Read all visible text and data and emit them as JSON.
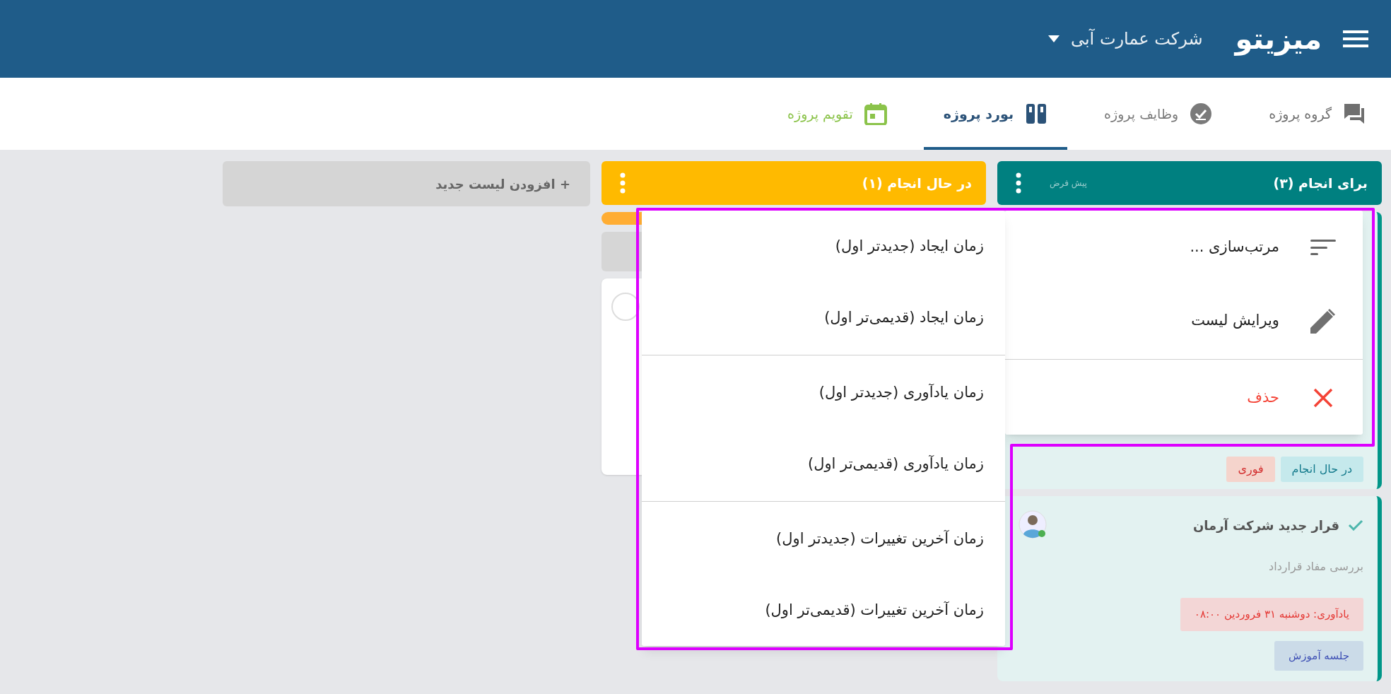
{
  "app": {
    "logo": "میزیتو",
    "company": "شرکت عمارت آبی"
  },
  "tabs": [
    {
      "label": "گروه پروژه",
      "kind": "chat",
      "color": "#6f6f6f",
      "selected": false
    },
    {
      "label": "وظایف پروژه",
      "kind": "tasks",
      "color": "#7a7a7a",
      "selected": false
    },
    {
      "label": "بورد پروژه",
      "kind": "board",
      "color": "#2b5278",
      "selected": true
    },
    {
      "label": "تقویم پروژه",
      "kind": "calendar",
      "color": "#8bc34a",
      "selected": false
    }
  ],
  "lists": [
    {
      "title": "برای انجام (۳)",
      "subtitle": "پیش فرض",
      "color": "#008080",
      "cards": [
        {
          "kind": "tags",
          "tags": [
            {
              "label": "در حال انجام",
              "kind": "status"
            },
            {
              "label": "فوری",
              "kind": "priority"
            }
          ]
        },
        {
          "kind": "task",
          "done": true,
          "title": "قرار جدید شرکت آرمان",
          "description": "بررسی مفاد قرارداد",
          "reminder": "یادآوری: دوشنبه ۳۱ فروردین ۰۸:۰۰",
          "label": "جلسه آموزش"
        }
      ]
    },
    {
      "title": "در حال انجام (۱)",
      "color": "#ffba00",
      "cards": [
        {
          "kind": "placeholder"
        }
      ]
    }
  ],
  "add_list": "+ افزودن لیست جدید",
  "menu": {
    "groups": [
      [
        {
          "kind": "sort",
          "label": "مرتب‌سازی ..."
        },
        {
          "kind": "edit",
          "label": "ویرایش لیست"
        }
      ],
      [
        {
          "kind": "delete",
          "label": "حذف"
        }
      ]
    ]
  },
  "submenu": {
    "groups": [
      [
        "زمان ایجاد (جدیدتر اول)",
        "زمان ایجاد (قدیمی‌تر اول)"
      ],
      [
        "زمان یادآوری (جدیدتر اول)",
        "زمان یادآوری (قدیمی‌تر اول)"
      ],
      [
        "زمان آخرین تغییرات (جدیدتر اول)",
        "زمان آخرین تغییرات (قدیمی‌تر اول)"
      ]
    ]
  }
}
